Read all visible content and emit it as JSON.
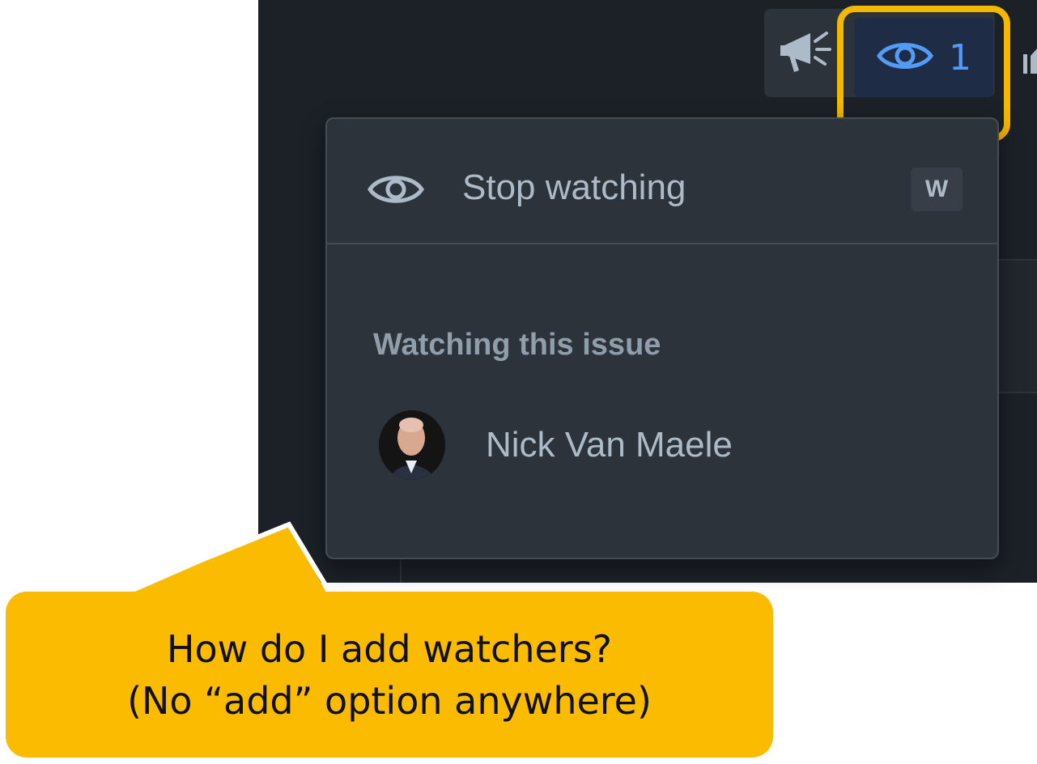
{
  "toolbar": {
    "announce_icon": "megaphone-icon",
    "watch_icon": "eye-icon",
    "watch_count": "1",
    "accent_color": "#539bf5"
  },
  "dropdown": {
    "stop_watching_label": "Stop watching",
    "stop_watching_shortcut": "W",
    "section_heading": "Watching this issue",
    "watchers": [
      {
        "name": "Nick Van Maele"
      }
    ]
  },
  "callout": {
    "line1": "How do I add watchers?",
    "line2": "(No “add” option anywhere)",
    "color": "#fbbb00"
  },
  "highlight_color": "#f5b800"
}
